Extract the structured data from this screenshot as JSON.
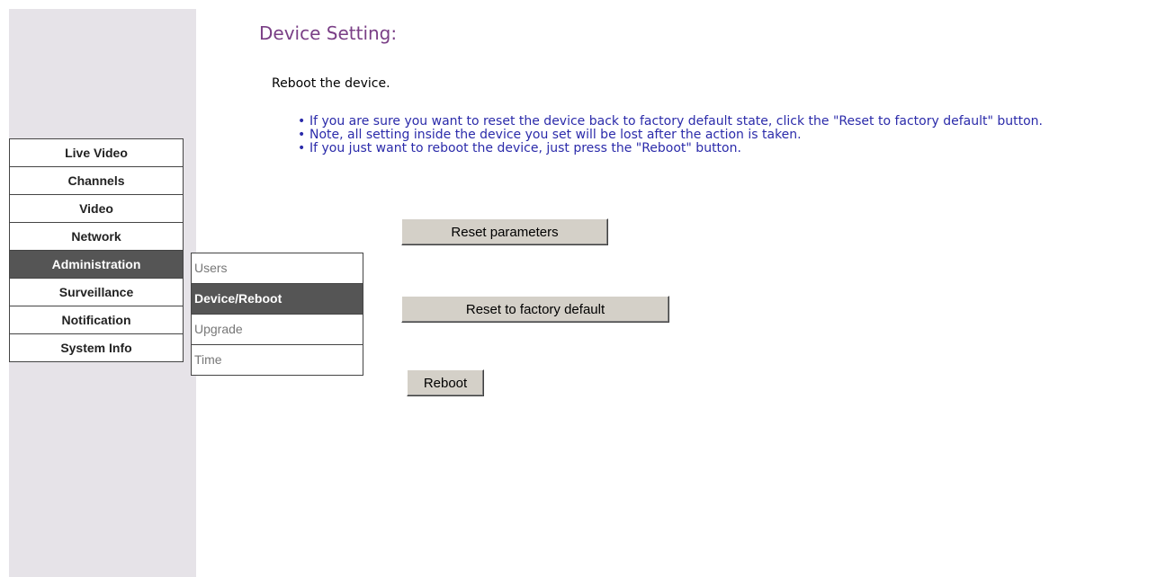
{
  "sidebar": {
    "main_menu": [
      {
        "label": "Live Video",
        "active": false
      },
      {
        "label": "Channels",
        "active": false
      },
      {
        "label": "Video",
        "active": false
      },
      {
        "label": "Network",
        "active": false
      },
      {
        "label": "Administration",
        "active": true
      },
      {
        "label": "Surveillance",
        "active": false
      },
      {
        "label": "Notification",
        "active": false
      },
      {
        "label": "System Info",
        "active": false
      }
    ],
    "sub_menu": [
      {
        "label": "Users",
        "active": false
      },
      {
        "label": "Device/Reboot",
        "active": true
      },
      {
        "label": "Upgrade",
        "active": false
      },
      {
        "label": "Time",
        "active": false
      }
    ]
  },
  "main": {
    "title": "Device Setting:",
    "intro": "Reboot the device.",
    "notes": [
      "If you are sure you want to reset the device back to factory default state, click the \"Reset to factory default\" button.",
      "Note, all setting inside the device you set will be lost after the action is taken.",
      "If you just want to reboot the device, just press the \"Reboot\" button."
    ],
    "buttons": {
      "reset_parameters": "Reset parameters",
      "reset_factory": "Reset to factory default",
      "reboot": "Reboot"
    }
  },
  "colors": {
    "title": "#7a3f86",
    "notes_text": "#2b2baa",
    "menu_active_bg": "#555555",
    "sidebar_bg": "#e6e3e8",
    "button_bg": "#d4d0c8"
  }
}
